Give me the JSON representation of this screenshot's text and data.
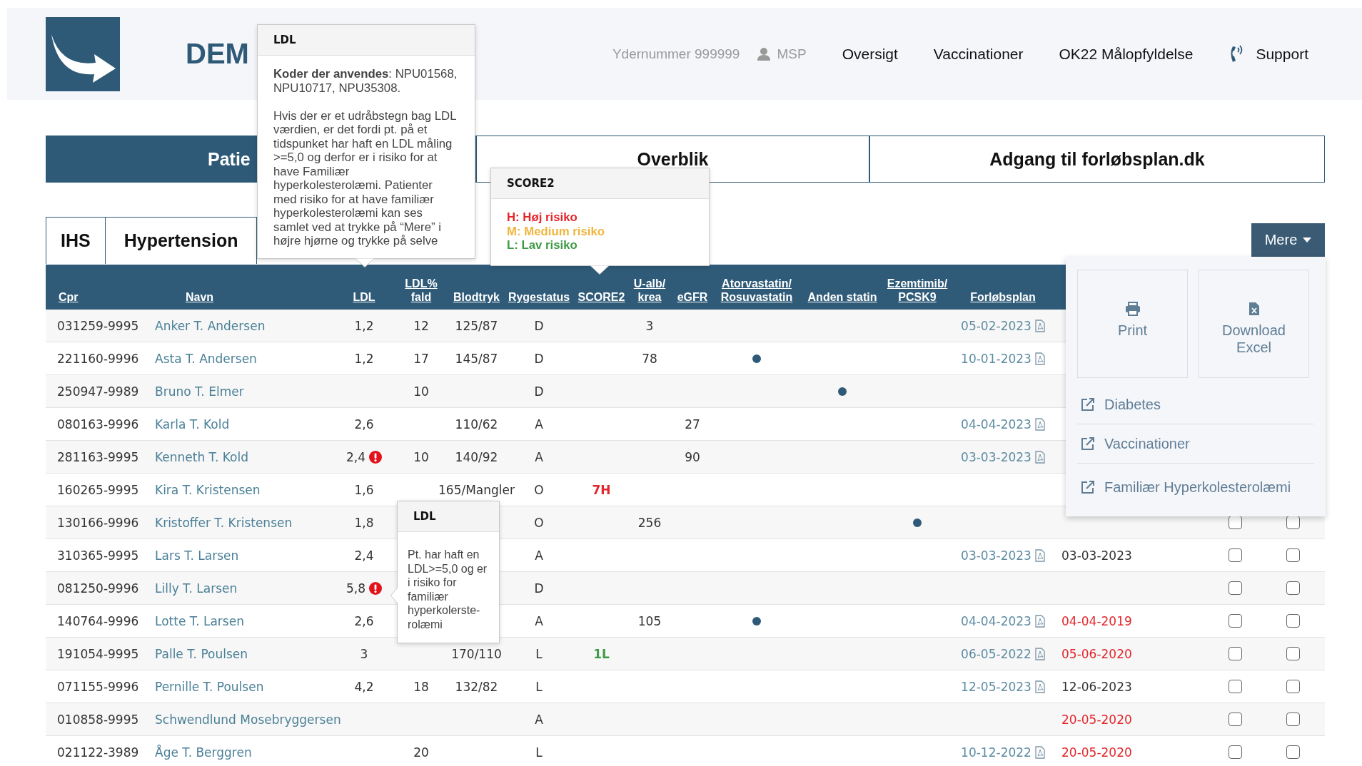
{
  "header": {
    "logo_text": "DEM",
    "nav": [
      {
        "kind": "info",
        "text": "Ydernummer 999999"
      },
      {
        "kind": "user",
        "text": "MSP"
      },
      {
        "kind": "link",
        "text": "Oversigt"
      },
      {
        "kind": "link",
        "text": "Vaccinationer"
      },
      {
        "kind": "link",
        "text": "OK22 Målopfyldelse"
      },
      {
        "kind": "phone",
        "text": "Support"
      }
    ]
  },
  "main_tabs": [
    {
      "label": "Patie",
      "selected": true
    },
    {
      "label": "Overblik",
      "selected": false
    },
    {
      "label": "Adgang til forløbsplan.dk",
      "selected": false
    }
  ],
  "sub_tabs": [
    {
      "label": "IHS",
      "selected": false
    },
    {
      "label": "Hypertension",
      "selected": false
    }
  ],
  "more_button": {
    "label": "Mere"
  },
  "more_menu": {
    "tiles": [
      {
        "kind": "print",
        "label": "Print"
      },
      {
        "kind": "excel",
        "label": "Download Excel"
      }
    ],
    "links": [
      "Diabetes",
      "Vaccinationer",
      "Familiær Hyperkolesterolæmi"
    ]
  },
  "table": {
    "columns": [
      "Cpr",
      "Navn",
      "LDL",
      "LDL%\nfald",
      "Blodtryk",
      "Rygestatus",
      "SCORE2",
      "U-alb/\nkrea",
      "eGFR",
      "Atorvastatin/\nRosuvastatin",
      "Anden statin",
      "Ezemtimib/\nPCSK9",
      "Forløbsplan"
    ],
    "rows": [
      {
        "cpr": "031259-9995",
        "name": "Anker T. Andersen",
        "ldl": "1,2",
        "ldl_alert": false,
        "ldl_fald": "12",
        "blodtryk": "125/87",
        "rygestatus": "D",
        "u_alb_krea": "3",
        "atorvastatin": false,
        "anden_statin": false,
        "ezemtimib": false,
        "forlobsplan": "05-02-2023"
      },
      {
        "cpr": "221160-9996",
        "name": "Asta T. Andersen",
        "ldl": "1,2",
        "ldl_alert": false,
        "ldl_fald": "17",
        "blodtryk": "145/87",
        "rygestatus": "D",
        "u_alb_krea": "78",
        "atorvastatin": true,
        "anden_statin": false,
        "ezemtimib": false,
        "forlobsplan": "10-01-2023"
      },
      {
        "cpr": "250947-9989",
        "name": "Bruno T. Elmer",
        "ldl_alert": false,
        "ldl_fald": "10",
        "rygestatus": "D",
        "atorvastatin": false,
        "anden_statin": true,
        "ezemtimib": false
      },
      {
        "cpr": "080163-9996",
        "name": "Karla T. Kold",
        "ldl": "2,6",
        "ldl_alert": false,
        "blodtryk": "110/62",
        "rygestatus": "A",
        "egfr": "27",
        "atorvastatin": false,
        "anden_statin": false,
        "ezemtimib": false,
        "forlobsplan": "04-04-2023"
      },
      {
        "cpr": "281163-9995",
        "name": "Kenneth T. Kold",
        "ldl": "2,4",
        "ldl_alert": true,
        "ldl_fald": "10",
        "blodtryk": "140/92",
        "rygestatus": "A",
        "egfr": "90",
        "atorvastatin": false,
        "anden_statin": false,
        "ezemtimib": false,
        "forlobsplan": "03-03-2023"
      },
      {
        "cpr": "160265-9995",
        "name": "Kira T. Kristensen",
        "ldl": "1,6",
        "ldl_alert": false,
        "blodtryk": "165/Mangler",
        "rygestatus": "O",
        "score2": {
          "text": "7H",
          "color": "#e3262b"
        },
        "atorvastatin": false,
        "anden_statin": false,
        "ezemtimib": false
      },
      {
        "cpr": "130166-9996",
        "name": "Kristoffer T. Kristensen",
        "ldl": "1,8",
        "ldl_alert": false,
        "rygestatus": "O",
        "u_alb_krea": "256",
        "atorvastatin": false,
        "anden_statin": false,
        "ezemtimib": true,
        "checkboxes": [
          {
            "checked": false
          },
          {
            "checked": false
          }
        ]
      },
      {
        "cpr": "310365-9995",
        "name": "Lars T. Larsen",
        "ldl": "2,4",
        "ldl_alert": false,
        "rygestatus": "A",
        "atorvastatin": false,
        "anden_statin": false,
        "ezemtimib": false,
        "forlobsplan": "03-03-2023",
        "column_14": {
          "text": "03-03-2023",
          "warning": false
        },
        "checkboxes": [
          {
            "checked": false
          },
          {
            "checked": false
          }
        ]
      },
      {
        "cpr": "081250-9996",
        "name": "Lilly T. Larsen",
        "ldl": "5,8",
        "ldl_alert": true,
        "rygestatus": "D",
        "atorvastatin": false,
        "anden_statin": false,
        "ezemtimib": false,
        "checkboxes": [
          {
            "checked": false
          },
          {
            "checked": false
          }
        ]
      },
      {
        "cpr": "140764-9996",
        "name": "Lotte T. Larsen",
        "ldl": "2,6",
        "ldl_alert": false,
        "rygestatus": "A",
        "u_alb_krea": "105",
        "atorvastatin": true,
        "anden_statin": false,
        "ezemtimib": false,
        "forlobsplan": "04-04-2023",
        "column_14": {
          "text": "04-04-2019",
          "warning": true
        },
        "checkboxes": [
          {
            "checked": false
          },
          {
            "checked": false
          }
        ]
      },
      {
        "cpr": "191054-9995",
        "name": "Palle T. Poulsen",
        "ldl": "3",
        "ldl_alert": false,
        "blodtryk": "170/110",
        "rygestatus": "L",
        "score2": {
          "text": "1L",
          "color": "#3f9a46"
        },
        "atorvastatin": false,
        "anden_statin": false,
        "ezemtimib": false,
        "forlobsplan": "06-05-2022",
        "column_14": {
          "text": "05-06-2020",
          "warning": true
        },
        "checkboxes": [
          {
            "checked": false
          },
          {
            "checked": false
          }
        ]
      },
      {
        "cpr": "071155-9996",
        "name": "Pernille T. Poulsen",
        "ldl": "4,2",
        "ldl_alert": false,
        "ldl_fald": "18",
        "blodtryk": "132/82",
        "rygestatus": "L",
        "atorvastatin": false,
        "anden_statin": false,
        "ezemtimib": false,
        "forlobsplan": "12-05-2023",
        "column_14": {
          "text": "12-06-2023",
          "warning": false
        },
        "checkboxes": [
          {
            "checked": false
          },
          {
            "checked": false
          }
        ]
      },
      {
        "cpr": "010858-9995",
        "name": "Schwendlund Mosebryggersen",
        "ldl_alert": false,
        "rygestatus": "A",
        "atorvastatin": false,
        "anden_statin": false,
        "ezemtimib": false,
        "column_14": {
          "text": "20-05-2020",
          "warning": true
        },
        "checkboxes": [
          {
            "checked": false
          },
          {
            "checked": false
          }
        ]
      },
      {
        "cpr": "021122-3989",
        "name": "Åge T. Berggren",
        "ldl_alert": false,
        "ldl_fald": "20",
        "rygestatus": "L",
        "atorvastatin": false,
        "anden_statin": false,
        "ezemtimib": false,
        "forlobsplan": "10-12-2022",
        "column_14": {
          "text": "20-05-2020",
          "warning": true
        },
        "checkboxes": [
          {
            "checked": false
          },
          {
            "checked": false
          }
        ]
      }
    ]
  },
  "tooltips": [
    {
      "kind": "ldl_info",
      "title": "LDL",
      "paragraphs": [
        "**Koder der anvendes**: NPU01568, NPU10717, NPU35308.",
        "Hvis der er et udråbstegn bag LDL værdien, er det fordi pt. på et tidspunket har haft en LDL måling >=5,0 og derfor er i risiko for at have Familiær hyperkolesterolæmi. Patienter med risiko for at have familiær hyperkolesterolæmi kan ses samlet ved at trykke på “Mere” i højre hjørne og trykke på selve"
      ]
    },
    {
      "kind": "score2",
      "title": "SCORE2",
      "lines": [
        {
          "text": "H: Høj risiko",
          "color": "#e3262b"
        },
        {
          "text": "M: Medium risiko",
          "color": "#efb53f"
        },
        {
          "text": "L: Lav risiko",
          "color": "#3f9a46"
        }
      ]
    },
    {
      "kind": "ldl_alert",
      "title": "LDL",
      "paragraphs": [
        "Pt. har haft en LDL>=5,0 og er i risiko for familiær hyperkolerste-rolæmi"
      ]
    }
  ]
}
